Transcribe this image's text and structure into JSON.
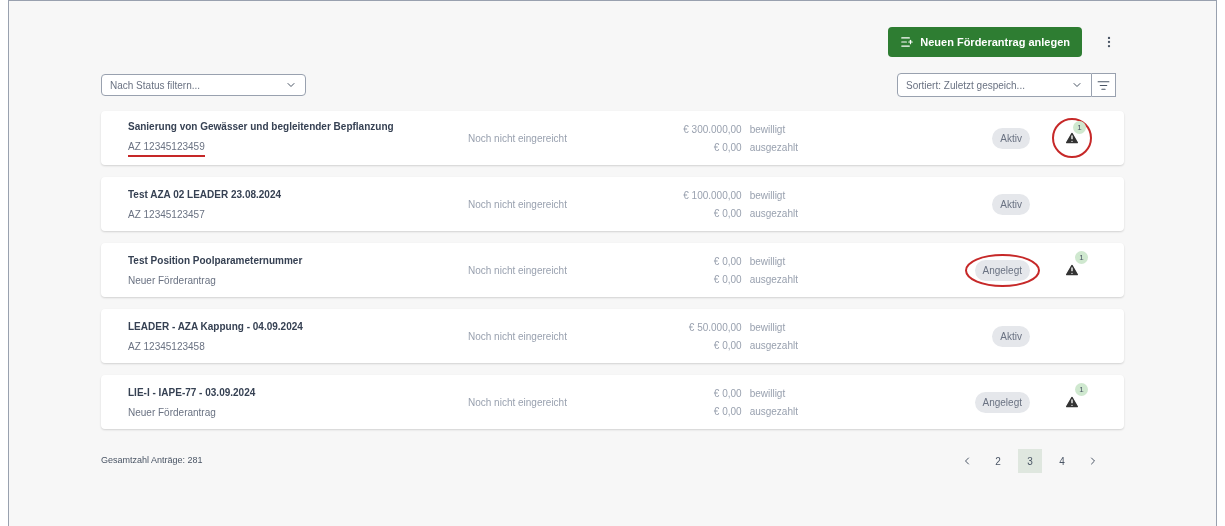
{
  "toolbar": {
    "new_button": "Neuen Förderantrag anlegen"
  },
  "filter": {
    "placeholder": "Nach Status filtern..."
  },
  "sort": {
    "value": "Sortiert: Zuletzt gespeich..."
  },
  "rows": [
    {
      "title": "Sanierung von Gewässer und begleitender Bepflanzung",
      "reference": "AZ 12345123459",
      "submission": "Noch nicht eingereicht",
      "approved": "€ 300.000,00",
      "approved_label": "bewilligt",
      "paid": "€ 0,00",
      "paid_label": "ausgezahlt",
      "status": "Aktiv",
      "warning_count": "1",
      "reference_underlined": true,
      "status_circled": false,
      "warning_circled": true
    },
    {
      "title": "Test AZA 02 LEADER 23.08.2024",
      "reference": "AZ 12345123457",
      "submission": "Noch nicht eingereicht",
      "approved": "€ 100.000,00",
      "approved_label": "bewilligt",
      "paid": "€ 0,00",
      "paid_label": "ausgezahlt",
      "status": "Aktiv",
      "reference_underlined": false,
      "status_circled": false
    },
    {
      "title": "Test Position Poolparameternummer",
      "reference": "Neuer Förderantrag",
      "submission": "Noch nicht eingereicht",
      "approved": "€ 0,00",
      "approved_label": "bewilligt",
      "paid": "€ 0,00",
      "paid_label": "ausgezahlt",
      "status": "Angelegt",
      "warning_count": "1",
      "reference_underlined": false,
      "status_circled": true,
      "warning_circled": false
    },
    {
      "title": "LEADER - AZA Kappung - 04.09.2024",
      "reference": "AZ 12345123458",
      "submission": "Noch nicht eingereicht",
      "approved": "€ 50.000,00",
      "approved_label": "bewilligt",
      "paid": "€ 0,00",
      "paid_label": "ausgezahlt",
      "status": "Aktiv",
      "reference_underlined": false,
      "status_circled": false
    },
    {
      "title": "LIE-I - IAPE-77 - 03.09.2024",
      "reference": "Neuer Förderantrag",
      "submission": "Noch nicht eingereicht",
      "approved": "€ 0,00",
      "approved_label": "bewilligt",
      "paid": "€ 0,00",
      "paid_label": "ausgezahlt",
      "status": "Angelegt",
      "warning_count": "1",
      "reference_underlined": false,
      "status_circled": false,
      "warning_circled": false
    }
  ],
  "total": "Gesamtzahl Anträge: 281",
  "pagination": [
    {
      "label": "2",
      "selected": false
    },
    {
      "label": "3",
      "selected": true
    },
    {
      "label": "4",
      "selected": false
    }
  ]
}
